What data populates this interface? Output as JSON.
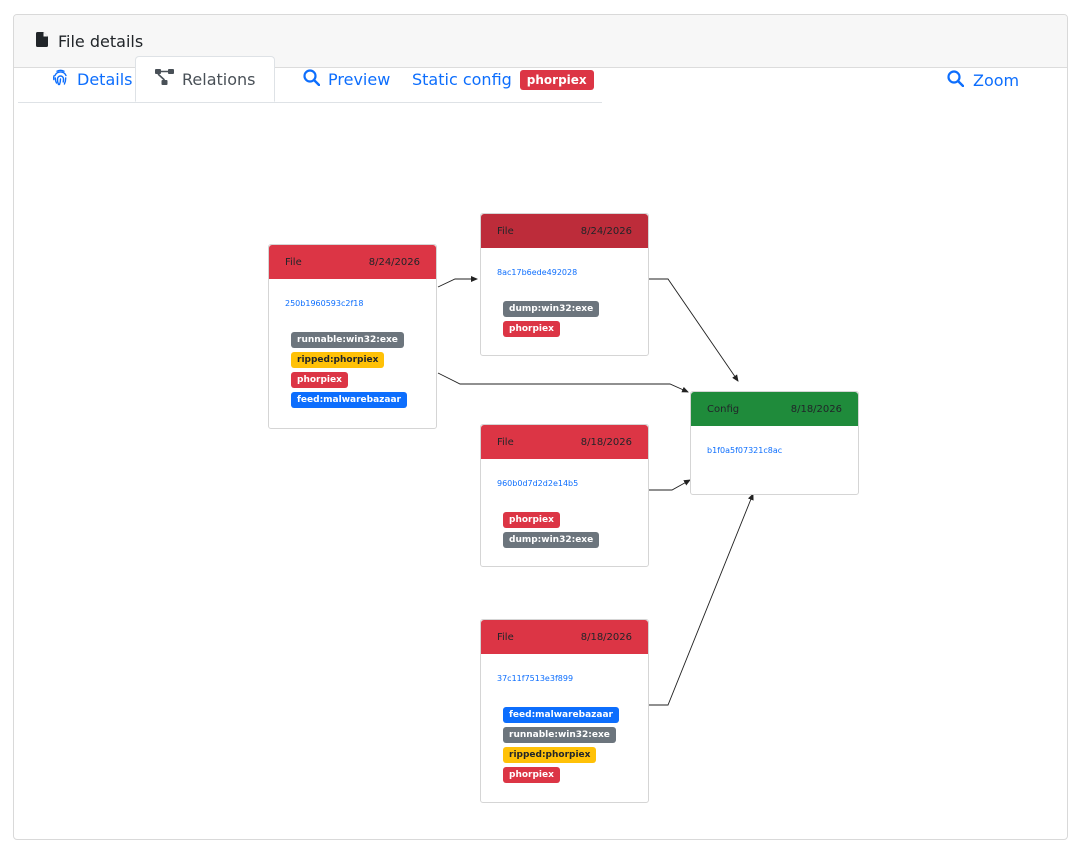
{
  "header": {
    "title": "File details"
  },
  "tabs": [
    {
      "label": "Details"
    },
    {
      "label": "Relations"
    },
    {
      "label": "Preview"
    },
    {
      "label": "Static config",
      "badge": "phorpiex"
    }
  ],
  "zoom": {
    "label": "Zoom"
  },
  "colors": {
    "red": "#dc3545",
    "dark_red": "#bd2c3a",
    "green": "#1f8b3b",
    "gray": "#6c757d",
    "yellow": "#ffc107",
    "blue": "#0d6efd"
  },
  "nodes": [
    {
      "type": "File",
      "date": "8/24/2026",
      "hash": "250b1960593c2f18",
      "tags": [
        {
          "text": "runnable:win32:exe",
          "color": "gray"
        },
        {
          "text": "ripped:phorpiex",
          "color": "yellow"
        },
        {
          "text": "phorpiex",
          "color": "red"
        },
        {
          "text": "feed:malwarebazaar",
          "color": "blue"
        }
      ]
    },
    {
      "type": "File",
      "date": "8/24/2026",
      "hash": "8ac17b6ede492028",
      "tags": [
        {
          "text": "dump:win32:exe",
          "color": "gray"
        },
        {
          "text": "phorpiex",
          "color": "red"
        }
      ]
    },
    {
      "type": "File",
      "date": "8/18/2026",
      "hash": "960b0d7d2d2e14b5",
      "tags": [
        {
          "text": "phorpiex",
          "color": "red"
        },
        {
          "text": "dump:win32:exe",
          "color": "gray"
        }
      ]
    },
    {
      "type": "File",
      "date": "8/18/2026",
      "hash": "37c11f7513e3f899",
      "tags": [
        {
          "text": "feed:malwarebazaar",
          "color": "blue"
        },
        {
          "text": "runnable:win32:exe",
          "color": "gray"
        },
        {
          "text": "ripped:phorpiex",
          "color": "yellow"
        },
        {
          "text": "phorpiex",
          "color": "red"
        }
      ]
    },
    {
      "type": "Config",
      "date": "8/18/2026",
      "hash": "b1f0a5f07321c8ac",
      "tags": []
    }
  ]
}
